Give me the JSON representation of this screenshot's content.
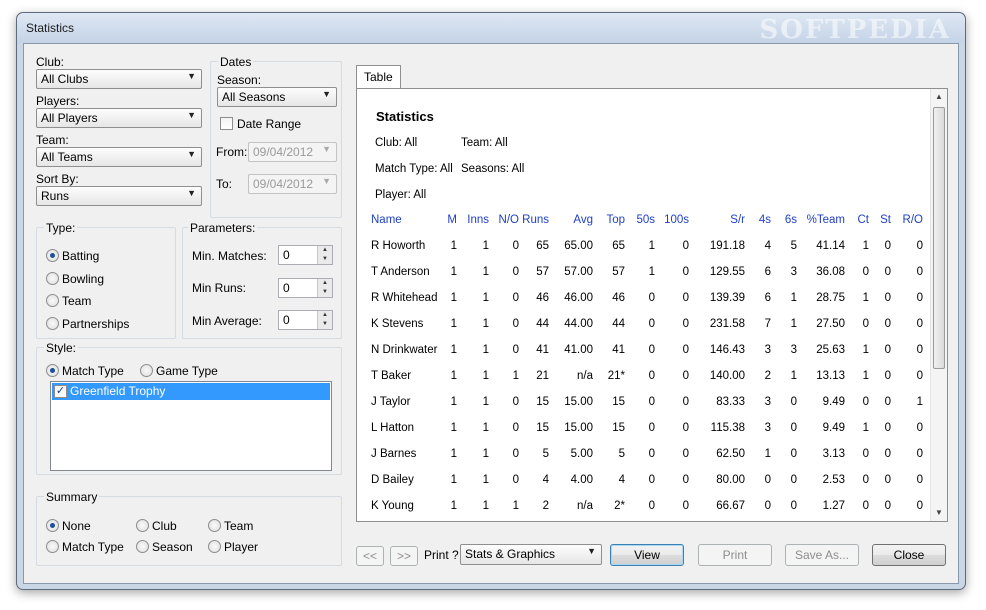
{
  "window": {
    "title": "Statistics",
    "watermark": "SOFTPEDIA"
  },
  "filters": {
    "club_label": "Club:",
    "club_value": "All Clubs",
    "players_label": "Players:",
    "players_value": "All Players",
    "team_label": "Team:",
    "team_value": "All Teams",
    "sortby_label": "Sort By:",
    "sortby_value": "Runs"
  },
  "dates": {
    "group_label": "Dates",
    "season_label": "Season:",
    "season_value": "All Seasons",
    "date_range_label": "Date Range",
    "date_range_checked": false,
    "from_label": "From:",
    "from_value": "09/04/2012",
    "to_label": "To:",
    "to_value": "09/04/2012"
  },
  "type": {
    "group_label": "Type:",
    "options": [
      {
        "label": "Batting",
        "selected": true
      },
      {
        "label": "Bowling",
        "selected": false
      },
      {
        "label": "Team",
        "selected": false
      },
      {
        "label": "Partnerships",
        "selected": false
      }
    ]
  },
  "parameters": {
    "group_label": "Parameters:",
    "min_matches_label": "Min. Matches:",
    "min_matches_value": "0",
    "min_runs_label": "Min Runs:",
    "min_runs_value": "0",
    "min_average_label": "Min Average:",
    "min_average_value": "0"
  },
  "style": {
    "group_label": "Style:",
    "match_type_label": "Match Type",
    "game_type_label": "Game Type",
    "selected": "Match Type",
    "list_items": [
      {
        "label": "Greenfield Trophy",
        "checked": true
      }
    ]
  },
  "summary": {
    "group_label": "Summary",
    "options": [
      {
        "label": "None",
        "selected": true
      },
      {
        "label": "Club",
        "selected": false
      },
      {
        "label": "Team",
        "selected": false
      },
      {
        "label": "Match Type",
        "selected": false
      },
      {
        "label": "Season",
        "selected": false
      },
      {
        "label": "Player",
        "selected": false
      }
    ]
  },
  "report": {
    "tab_label": "Table",
    "heading": "Statistics",
    "club_text": "Club: All",
    "team_text": "Team: All",
    "match_type_text": "Match Type: All",
    "seasons_text": "Seasons: All",
    "player_text": "Player: All",
    "columns": [
      "Name",
      "M",
      "Inns",
      "N/O",
      "Runs",
      "Avg",
      "Top",
      "50s",
      "100s",
      "S/r",
      "4s",
      "6s",
      "%Team",
      "Ct",
      "St",
      "R/O"
    ],
    "rows": [
      [
        "R Howorth",
        "1",
        "1",
        "0",
        "65",
        "65.00",
        "65",
        "1",
        "0",
        "191.18",
        "4",
        "5",
        "41.14",
        "1",
        "0",
        "0"
      ],
      [
        "T Anderson",
        "1",
        "1",
        "0",
        "57",
        "57.00",
        "57",
        "1",
        "0",
        "129.55",
        "6",
        "3",
        "36.08",
        "0",
        "0",
        "0"
      ],
      [
        "R Whitehead",
        "1",
        "1",
        "0",
        "46",
        "46.00",
        "46",
        "0",
        "0",
        "139.39",
        "6",
        "1",
        "28.75",
        "1",
        "0",
        "0"
      ],
      [
        "K Stevens",
        "1",
        "1",
        "0",
        "44",
        "44.00",
        "44",
        "0",
        "0",
        "231.58",
        "7",
        "1",
        "27.50",
        "0",
        "0",
        "0"
      ],
      [
        "N Drinkwater",
        "1",
        "1",
        "0",
        "41",
        "41.00",
        "41",
        "0",
        "0",
        "146.43",
        "3",
        "3",
        "25.63",
        "1",
        "0",
        "0"
      ],
      [
        "T Baker",
        "1",
        "1",
        "1",
        "21",
        "n/a",
        "21*",
        "0",
        "0",
        "140.00",
        "2",
        "1",
        "13.13",
        "1",
        "0",
        "0"
      ],
      [
        "J Taylor",
        "1",
        "1",
        "0",
        "15",
        "15.00",
        "15",
        "0",
        "0",
        "83.33",
        "3",
        "0",
        "9.49",
        "0",
        "0",
        "1"
      ],
      [
        "L Hatton",
        "1",
        "1",
        "0",
        "15",
        "15.00",
        "15",
        "0",
        "0",
        "115.38",
        "3",
        "0",
        "9.49",
        "1",
        "0",
        "0"
      ],
      [
        "J Barnes",
        "1",
        "1",
        "0",
        "5",
        "5.00",
        "5",
        "0",
        "0",
        "62.50",
        "1",
        "0",
        "3.13",
        "0",
        "0",
        "0"
      ],
      [
        "D Bailey",
        "1",
        "1",
        "0",
        "4",
        "4.00",
        "4",
        "0",
        "0",
        "80.00",
        "0",
        "0",
        "2.53",
        "0",
        "0",
        "0"
      ],
      [
        "K Young",
        "1",
        "1",
        "1",
        "2",
        "n/a",
        "2*",
        "0",
        "0",
        "66.67",
        "0",
        "0",
        "1.27",
        "0",
        "0",
        "0"
      ]
    ]
  },
  "bottom": {
    "prev_label": "<<",
    "next_label": ">>",
    "print_label": "Print ?",
    "print_option": "Stats & Graphics",
    "view_label": "View",
    "print_button_label": "Print",
    "save_as_label": "Save As...",
    "close_label": "Close"
  },
  "colors": {
    "header_blue": "#1f3fc4",
    "selection_blue": "#3399ff"
  }
}
